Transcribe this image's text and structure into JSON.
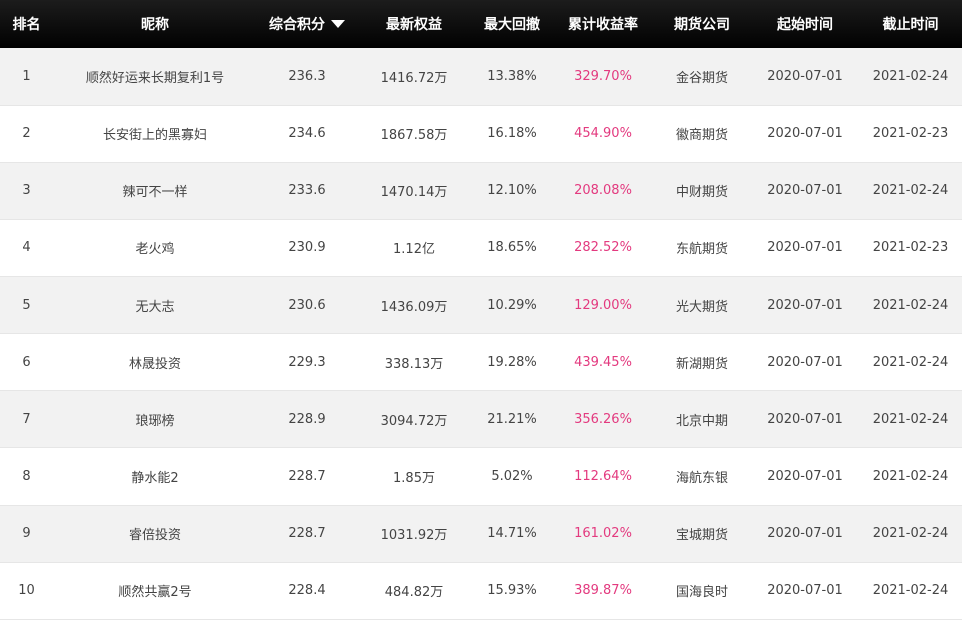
{
  "header": {
    "rank": "排名",
    "nickname": "昵称",
    "score": "综合积分",
    "equity": "最新权益",
    "max_drawdown": "最大回撤",
    "cumulative_return": "累计收益率",
    "broker": "期货公司",
    "start_date": "起始时间",
    "end_date": "截止时间"
  },
  "rows": [
    {
      "rank": "1",
      "nickname": "顺然好运来长期复利1号",
      "score": "236.3",
      "equity": "1416.72万",
      "max_drawdown": "13.38%",
      "cumulative_return": "329.70%",
      "broker": "金谷期货",
      "start_date": "2020-07-01",
      "end_date": "2021-02-24"
    },
    {
      "rank": "2",
      "nickname": "长安街上的黑寡妇",
      "score": "234.6",
      "equity": "1867.58万",
      "max_drawdown": "16.18%",
      "cumulative_return": "454.90%",
      "broker": "徽商期货",
      "start_date": "2020-07-01",
      "end_date": "2021-02-23"
    },
    {
      "rank": "3",
      "nickname": "辣可不一样",
      "score": "233.6",
      "equity": "1470.14万",
      "max_drawdown": "12.10%",
      "cumulative_return": "208.08%",
      "broker": "中财期货",
      "start_date": "2020-07-01",
      "end_date": "2021-02-24"
    },
    {
      "rank": "4",
      "nickname": "老火鸡",
      "score": "230.9",
      "equity": "1.12亿",
      "max_drawdown": "18.65%",
      "cumulative_return": "282.52%",
      "broker": "东航期货",
      "start_date": "2020-07-01",
      "end_date": "2021-02-23"
    },
    {
      "rank": "5",
      "nickname": "无大志",
      "score": "230.6",
      "equity": "1436.09万",
      "max_drawdown": "10.29%",
      "cumulative_return": "129.00%",
      "broker": "光大期货",
      "start_date": "2020-07-01",
      "end_date": "2021-02-24"
    },
    {
      "rank": "6",
      "nickname": "林晟投资",
      "score": "229.3",
      "equity": "338.13万",
      "max_drawdown": "19.28%",
      "cumulative_return": "439.45%",
      "broker": "新湖期货",
      "start_date": "2020-07-01",
      "end_date": "2021-02-24"
    },
    {
      "rank": "7",
      "nickname": "琅琊榜",
      "score": "228.9",
      "equity": "3094.72万",
      "max_drawdown": "21.21%",
      "cumulative_return": "356.26%",
      "broker": "北京中期",
      "start_date": "2020-07-01",
      "end_date": "2021-02-24"
    },
    {
      "rank": "8",
      "nickname": "静水能2",
      "score": "228.7",
      "equity": "1.85万",
      "max_drawdown": "5.02%",
      "cumulative_return": "112.64%",
      "broker": "海航东银",
      "start_date": "2020-07-01",
      "end_date": "2021-02-24"
    },
    {
      "rank": "9",
      "nickname": "睿倍投资",
      "score": "228.7",
      "equity": "1031.92万",
      "max_drawdown": "14.71%",
      "cumulative_return": "161.02%",
      "broker": "宝城期货",
      "start_date": "2020-07-01",
      "end_date": "2021-02-24"
    },
    {
      "rank": "10",
      "nickname": "顺然共赢2号",
      "score": "228.4",
      "equity": "484.82万",
      "max_drawdown": "15.93%",
      "cumulative_return": "389.87%",
      "broker": "国海良时",
      "start_date": "2020-07-01",
      "end_date": "2021-02-24"
    }
  ],
  "icons": {
    "sort": "sort-descending-icon"
  },
  "colors": {
    "header_bg": "#0a0a0a",
    "header_text": "#ffffff",
    "row_odd": "#f2f2f2",
    "row_even": "#ffffff",
    "return_text": "#e33a7f",
    "body_text": "#444444"
  }
}
